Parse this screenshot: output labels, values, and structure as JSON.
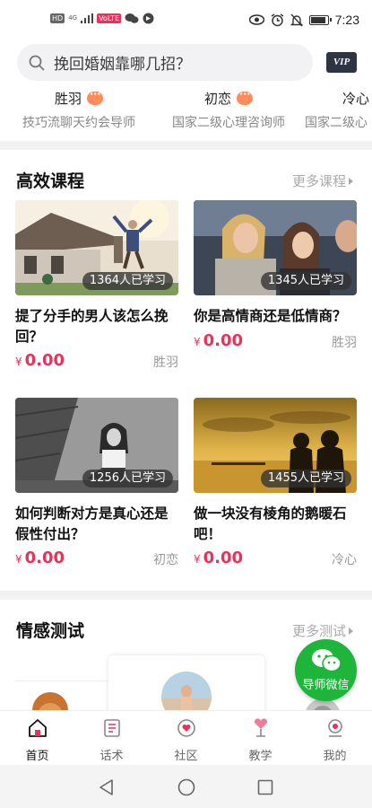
{
  "status_bar": {
    "time": "7:23",
    "chips": [
      "HD",
      "4G",
      "VoLTE"
    ],
    "icons": [
      "signal-icon",
      "wechat-icon",
      "eye-icon",
      "alarm-icon",
      "mute-icon",
      "battery-icon"
    ]
  },
  "search": {
    "placeholder": "挽回婚姻靠哪几招？",
    "vip_label": "VIP"
  },
  "mentors": [
    {
      "name": "胜羽",
      "title": "技巧流聊天约会导师"
    },
    {
      "name": "初恋",
      "title": "国家二级心理咨询师"
    },
    {
      "name": "冷心",
      "title": "国家二级心"
    }
  ],
  "courses": {
    "section_title": "高效课程",
    "more_label": "更多课程",
    "items": [
      {
        "title": "提了分手的男人该怎么挽回？",
        "learners": "1364人已学习",
        "currency": "¥",
        "price": "0.00",
        "teacher": "胜羽"
      },
      {
        "title": "你是高情商还是低情商？",
        "learners": "1345人已学习",
        "currency": "¥",
        "price": "0.00",
        "teacher": "胜羽"
      },
      {
        "title": "如何判断对方是真心还是假性付出？",
        "learners": "1256人已学习",
        "currency": "¥",
        "price": "0.00",
        "teacher": "初恋"
      },
      {
        "title": "做一块没有棱角的鹅暖石吧！",
        "learners": "1455人已学习",
        "currency": "¥",
        "price": "0.00",
        "teacher": "冷心"
      }
    ]
  },
  "tests": {
    "section_title": "情感测试",
    "more_label": "更多测试"
  },
  "wechat_fab": {
    "label": "导师微信"
  },
  "tabbar": {
    "items": [
      {
        "label": "首页",
        "icon": "home-icon",
        "active": true
      },
      {
        "label": "话术",
        "icon": "script-icon",
        "active": false
      },
      {
        "label": "社区",
        "icon": "community-icon",
        "active": false
      },
      {
        "label": "教学",
        "icon": "teaching-icon",
        "active": false
      },
      {
        "label": "我的",
        "icon": "profile-icon",
        "active": false
      }
    ]
  },
  "colors": {
    "accent": "#e8325a",
    "wechat_green": "#1db53a",
    "muted_text": "#999999"
  }
}
